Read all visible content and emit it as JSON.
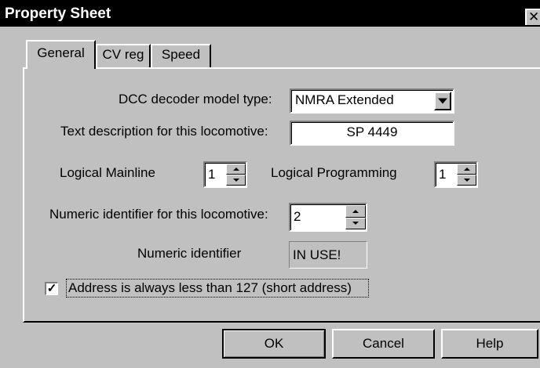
{
  "window": {
    "title": "Property Sheet",
    "close_glyph": "✕"
  },
  "tabs": [
    {
      "label": "General",
      "active": true
    },
    {
      "label": "CV reg",
      "active": false
    },
    {
      "label": "Speed",
      "active": false
    }
  ],
  "general": {
    "decoder_type_label": "DCC decoder model type:",
    "decoder_type_value": "NMRA Extended",
    "description_label": "Text description for this locomotive:",
    "description_value": "SP 4449",
    "logical_mainline_label": "Logical Mainline",
    "logical_mainline_value": "1",
    "logical_programming_label": "Logical Programming",
    "logical_programming_value": "1",
    "numeric_id_label": "Numeric identifier for this locomotive:",
    "numeric_id_value": "2",
    "numeric_status_label": "Numeric identifier",
    "numeric_status_value": "IN USE!",
    "short_address_label": "Address is always less than 127 (short address)",
    "short_address_checked": true,
    "check_glyph": "✓"
  },
  "buttons": {
    "ok": "OK",
    "cancel": "Cancel",
    "help": "Help"
  },
  "icons": {
    "close": "close-icon",
    "dropdown": "chevron-down-icon",
    "spin_up": "spin-up-icon",
    "spin_down": "spin-down-icon",
    "check": "check-icon"
  },
  "colors": {
    "title_bar": "#000000",
    "face": "#c0c0c0",
    "field": "#ffffff"
  }
}
